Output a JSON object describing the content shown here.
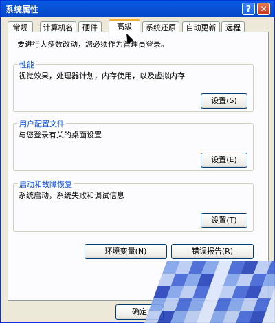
{
  "window": {
    "title": "系统属性",
    "help_glyph": "?",
    "close_glyph": "✕"
  },
  "tabs": [
    "常规",
    "计算机名",
    "硬件",
    "高级",
    "系统还原",
    "自动更新",
    "远程"
  ],
  "selected_tab": "高级",
  "notice": "要进行大多数改动，您必须作为管理员登录。",
  "sections": [
    {
      "title": "性能",
      "description": "视觉效果，处理器计划，内存使用，以及虚拟内存",
      "button": "设置(S)"
    },
    {
      "title": "用户配置文件",
      "description": "与您登录有关的桌面设置",
      "button": "设置(E)"
    },
    {
      "title": "启动和故障恢复",
      "description": "系统启动，系统失败和调试信息",
      "button": "设置(T)"
    }
  ],
  "bottom_buttons": {
    "env": "环境变量(N)",
    "error": "错误报告(R)"
  },
  "footer": {
    "ok": "确定"
  },
  "colors": {
    "titlebar": "#0a5ce6",
    "group_title": "#0046d5",
    "tab_highlight": "#f1b034"
  }
}
